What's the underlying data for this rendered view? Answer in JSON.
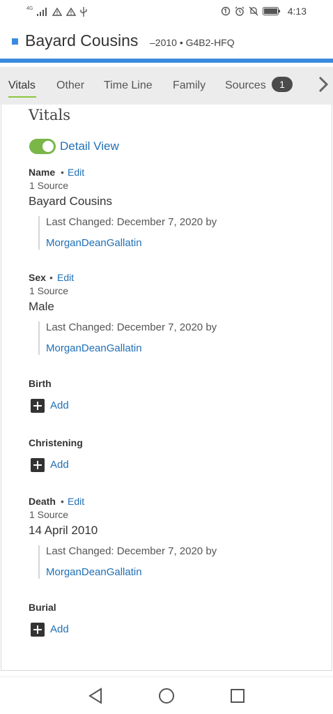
{
  "status_bar": {
    "network_label": "4G",
    "time": "4:13"
  },
  "header": {
    "name": "Bayard Cousins",
    "meta": "–2010 • G4B2-HFQ"
  },
  "tabs": [
    {
      "label": "Vitals",
      "active": true
    },
    {
      "label": "Other",
      "active": false
    },
    {
      "label": "Time Line",
      "active": false
    },
    {
      "label": "Family",
      "active": false
    },
    {
      "label": "Sources",
      "active": false,
      "badge": "1"
    }
  ],
  "vitals": {
    "title": "Vitals",
    "detail_view_label": "Detail View",
    "detail_view_on": true,
    "dot": "•",
    "edit_label": "Edit",
    "add_label": "Add",
    "name": {
      "label": "Name",
      "sources": "1 Source",
      "value": "Bayard Cousins",
      "last_changed": "Last Changed: December 7, 2020 by",
      "user": "MorganDeanGallatin"
    },
    "sex": {
      "label": "Sex",
      "sources": "1 Source",
      "value": "Male",
      "last_changed": "Last Changed: December 7, 2020 by",
      "user": "MorganDeanGallatin"
    },
    "birth": {
      "label": "Birth"
    },
    "christening": {
      "label": "Christening"
    },
    "death": {
      "label": "Death",
      "sources": "1 Source",
      "value": "14 April 2010",
      "last_changed": "Last Changed: December 7, 2020 by",
      "user": "MorganDeanGallatin"
    },
    "burial": {
      "label": "Burial"
    }
  },
  "colors": {
    "accent_blue": "#3a8be0",
    "link_blue": "#1f6fb5",
    "toggle_green": "#7ab648",
    "tab_underline": "#8dc63f"
  }
}
